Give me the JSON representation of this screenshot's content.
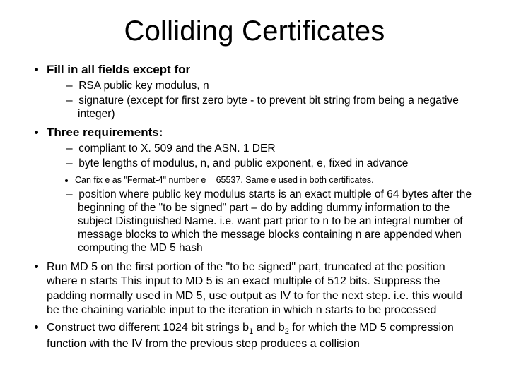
{
  "title": "Colliding Certificates",
  "b1": {
    "header": "Fill in all fields except for",
    "s1": "RSA public key modulus, n",
    "s2": "signature (except for first zero byte - to prevent bit string from being a negative integer)"
  },
  "b2": {
    "header": "Three requirements:",
    "s1": "compliant to X. 509 and the ASN. 1 DER",
    "s2": "byte lengths of modulus, n,  and public exponent, e,  fixed in advance",
    "note": "Can fix  e as  \"Fermat-4\" number e = 65537. Same e used in  both certificates.",
    "s3": "position where public key modulus starts is an exact multiple of 64 bytes after the beginning of the \"to be signed\" part – do by adding dummy information to the subject Distinguished Name. i.e. want part prior to n to be an integral number of message blocks to which the message blocks containing n are appended when computing the MD 5 hash"
  },
  "b3": {
    "text": "Run MD 5  on the first portion of the \"to be signed\" part, truncated at the position where n starts This input to MD 5 is an exact multiple of 512 bits. Suppress the padding normally used in MD 5, use output as IV to for the next step. i.e. this would be the chaining variable input to the iteration in which n starts to be processed"
  },
  "b4": {
    "pre": "Construct two different 1024 bit strings b",
    "sub1": "1",
    "mid": " and b",
    "sub2": "2",
    "post": " for which the MD 5 compression function with the IV from the previous step produces a collision"
  }
}
